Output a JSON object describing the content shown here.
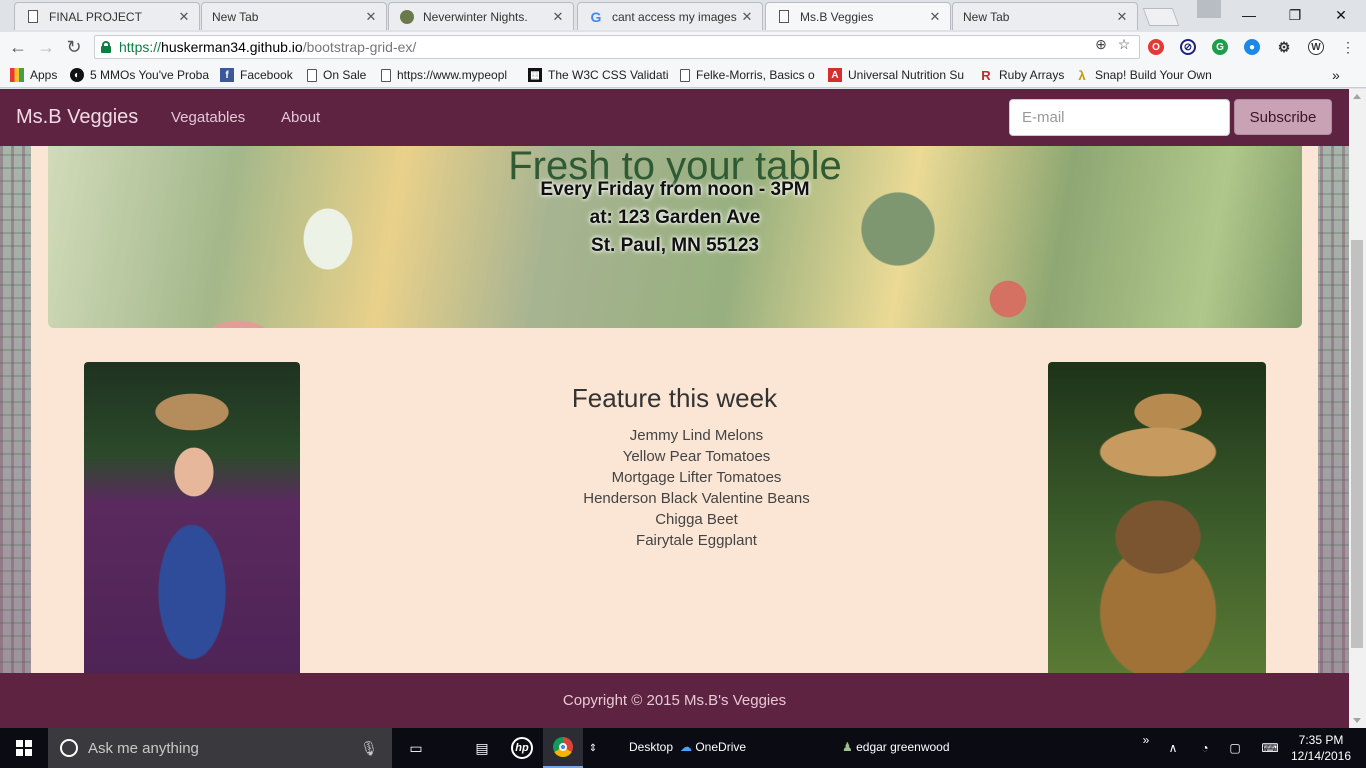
{
  "browser": {
    "tabs": [
      {
        "title": "FINAL PROJECT",
        "icon": "document-icon"
      },
      {
        "title": "New Tab",
        "icon": ""
      },
      {
        "title": "Neverwinter Nights.",
        "icon": "game-icon"
      },
      {
        "title": "cant access my images i",
        "icon": "google-icon"
      },
      {
        "title": "Ms.B Veggies",
        "icon": "document-icon"
      },
      {
        "title": "New Tab",
        "icon": ""
      }
    ],
    "active_tab": 4,
    "url": {
      "scheme": "https://",
      "host": "huskerman34.github.io",
      "path": "/bootstrap-grid-ex/"
    },
    "bookmarks": [
      {
        "label": "Apps",
        "icon": "apps-icon"
      },
      {
        "label": "5 MMOs You've Proba",
        "icon": "steam-icon"
      },
      {
        "label": "Facebook",
        "icon": "facebook-icon"
      },
      {
        "label": "On Sale",
        "icon": "document-icon"
      },
      {
        "label": "https://www.mypeopl",
        "icon": "document-icon"
      },
      {
        "label": "The W3C CSS Validati",
        "icon": "w3c-icon"
      },
      {
        "label": "Felke-Morris, Basics o",
        "icon": "document-icon"
      },
      {
        "label": "Universal Nutrition Su",
        "icon": "nutrition-icon"
      },
      {
        "label": "Ruby Arrays",
        "icon": "ruby-icon"
      },
      {
        "label": "Snap! Build Your Own",
        "icon": "snap-icon"
      }
    ],
    "more_bookmarks": "»"
  },
  "page": {
    "navbar": {
      "brand": "Ms.B Veggies",
      "links": [
        "Vegatables",
        "About"
      ],
      "email_placeholder": "E-mail",
      "subscribe_label": "Subscribe"
    },
    "jumbotron": {
      "headline": "Fresh to your table",
      "lines": [
        "Every Friday from noon - 3PM",
        "at: 123 Garden Ave",
        "St. Paul, MN 55123"
      ]
    },
    "feature": {
      "title": "Feature this week",
      "items": [
        "Jemmy Lind Melons",
        "Yellow Pear Tomatoes",
        "Mortgage Lifter Tomatoes",
        "Henderson Black Valentine Beans",
        "Chigga Beet",
        "Fairytale Eggplant"
      ]
    },
    "footer": "Copyright © 2015 Ms.B's Veggies"
  },
  "taskbar": {
    "search_placeholder": "Ask me anything",
    "desktop_label": "Desktop",
    "onedrive_label": "OneDrive",
    "user_label": "edgar greenwood",
    "time": "7:35 PM",
    "date": "12/14/2016"
  },
  "colors": {
    "navbar": "#5d2341",
    "page_background": "#fbe6d6",
    "subscribe_button": "#c9a2b6",
    "secure_green": "#0b8043"
  }
}
